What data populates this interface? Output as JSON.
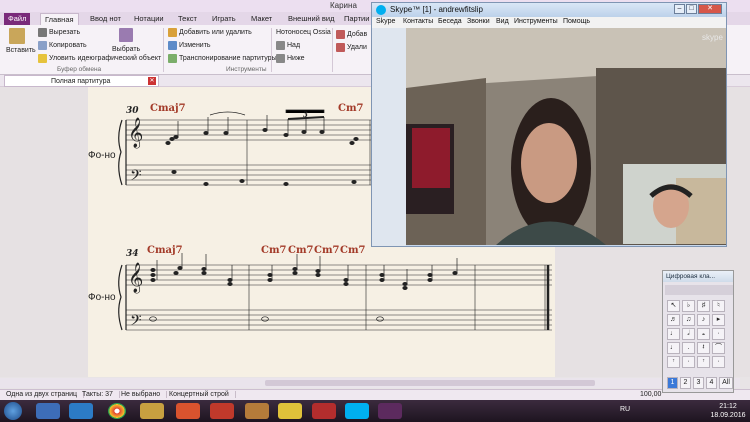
{
  "sibelius": {
    "title_partial": "Карина",
    "tabs": [
      "Файл",
      "Главная",
      "Ввод нот",
      "Нотации",
      "Текст",
      "Играть",
      "Макет",
      "Внешний вид",
      "Партии"
    ],
    "ribbon": {
      "paste": "Вставить",
      "cut": "Вырезать",
      "copy": "Копировать",
      "delete_idea": "Уловить идею",
      "select": "Выбрать",
      "graphic_object": "графический объект",
      "clipboard_group": "Буфер обмена",
      "add_remove": "Добавить или удалить",
      "change": "Изменить",
      "transpose_score": "Транспонирование партитуры",
      "instruments_group": "Инструменты",
      "ossia": "Нотоносец Ossia",
      "above": "Над",
      "below": "Ниже",
      "add_partial": "Добав",
      "delete_partial": "Удали"
    },
    "doc_tab": "Полная партитура",
    "score": {
      "system1": {
        "bar_number": "30",
        "instrument": "Фо-но",
        "chords": [
          "Cmaj7",
          "Cm7"
        ],
        "tuplet": "3"
      },
      "system2": {
        "bar_number": "34",
        "instrument": "Фо-но",
        "chords": [
          "Cmaj7",
          "Cm7",
          "Cm7",
          "Cm7",
          "Cm7"
        ]
      }
    },
    "status": {
      "page": "Одна из двух страниц",
      "bars": "Такты: 37",
      "selection": "Не выбрано",
      "pitch": "Концертный строй",
      "zoom": "100,00"
    }
  },
  "skype": {
    "title": "Skype™ [1] - andrewfitslip",
    "menu": [
      "Skype",
      "Контакты",
      "Беседа",
      "Звонки",
      "Вид",
      "Инструменты",
      "Помощь"
    ],
    "watermark": "skype"
  },
  "keypad": {
    "title": "Цифровая кла...",
    "tabs": [
      "1",
      "2",
      "3",
      "4",
      "All"
    ]
  },
  "taskbar": {
    "language": "RU",
    "time": "21:12",
    "date": "18.09.2016"
  },
  "colors": {
    "file_tab": "#7a2a7a",
    "chord_symbol": "#a33a28",
    "desktop": "#5a1d4f"
  }
}
